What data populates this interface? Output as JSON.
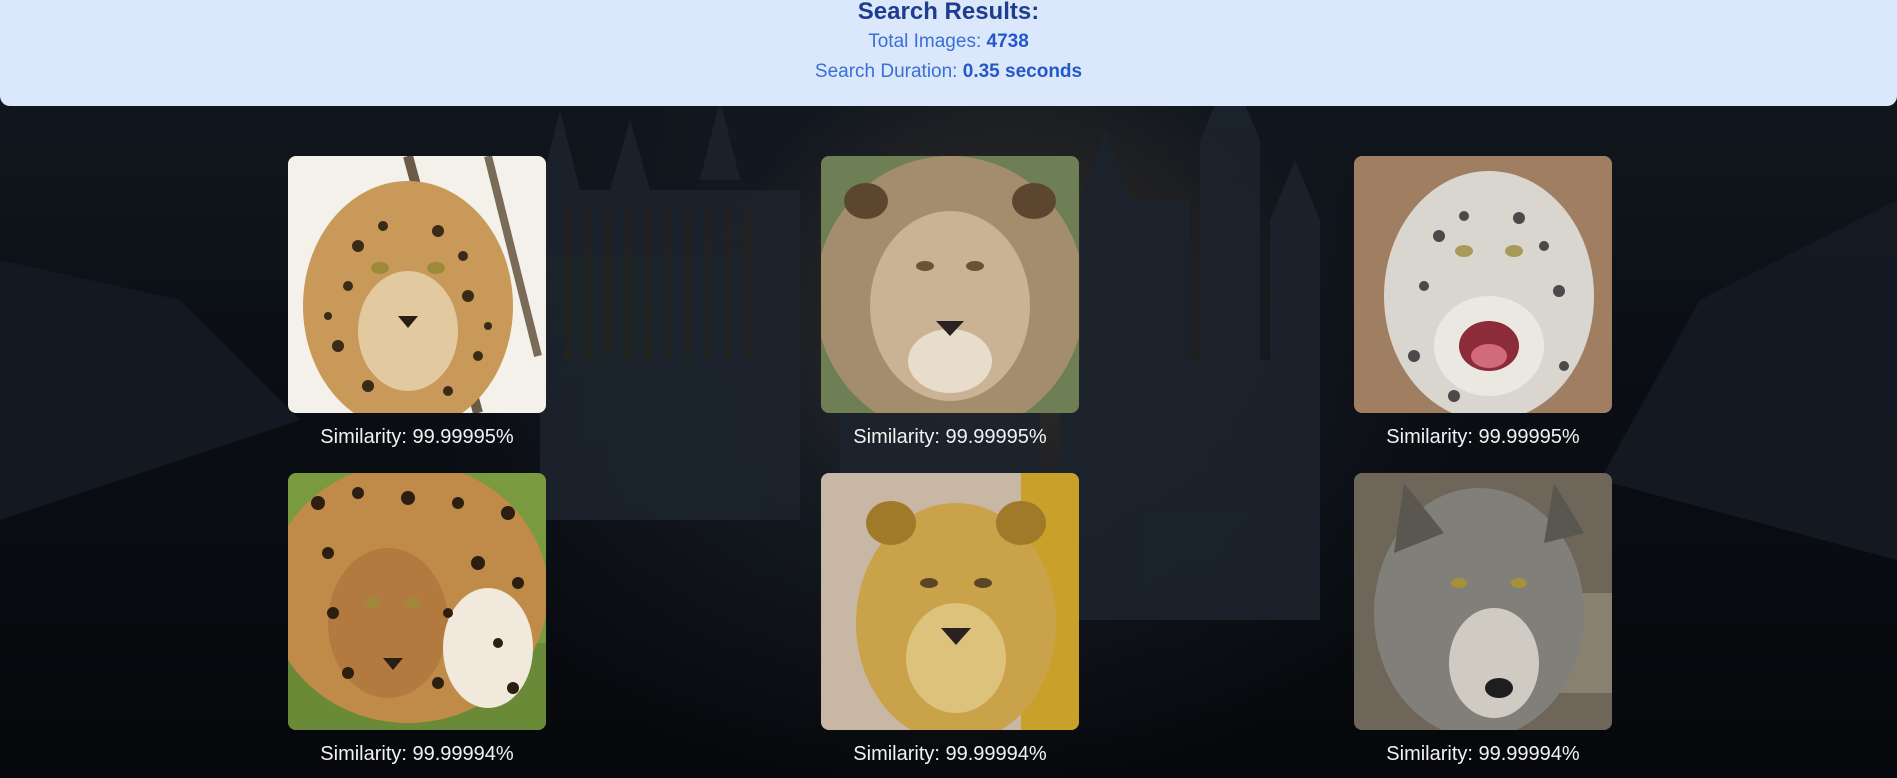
{
  "results": {
    "title": "Search Results:",
    "total_label": "Total Images: ",
    "total_value": "4738",
    "duration_label": "Search Duration: ",
    "duration_value": "0.35 seconds"
  },
  "images": [
    {
      "animal": "leopard",
      "caption": "Similarity: 99.99995%"
    },
    {
      "animal": "lion",
      "caption": "Similarity: 99.99995%"
    },
    {
      "animal": "snow-leopard",
      "caption": "Similarity: 99.99995%"
    },
    {
      "animal": "jaguar",
      "caption": "Similarity: 99.99994%"
    },
    {
      "animal": "lioness",
      "caption": "Similarity: 99.99994%"
    },
    {
      "animal": "wolf",
      "caption": "Similarity: 99.99994%"
    }
  ]
}
